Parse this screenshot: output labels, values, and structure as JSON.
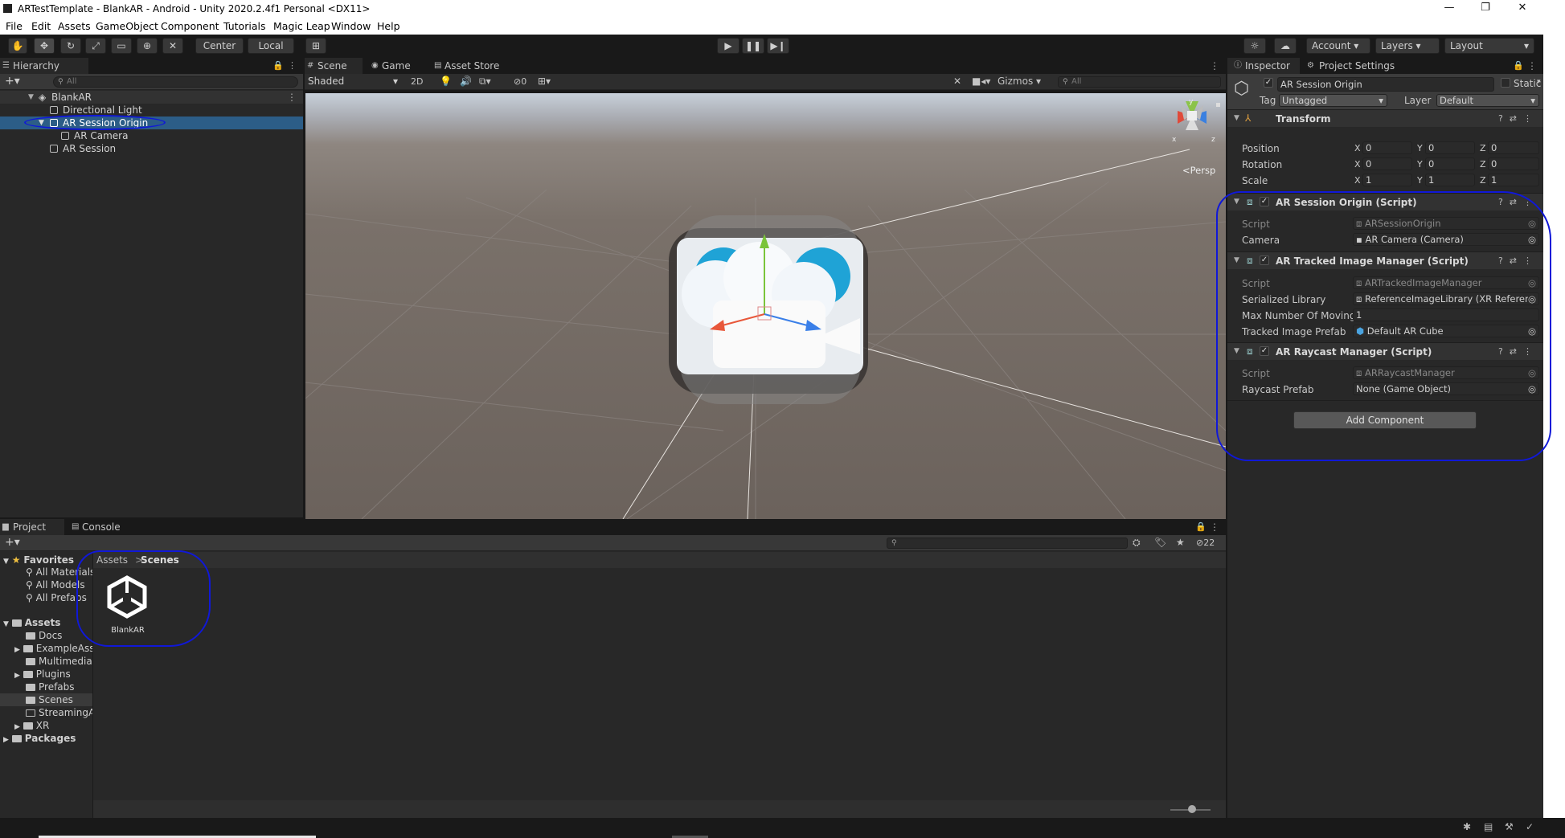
{
  "window": {
    "title": "ARTestTemplate - BlankAR - Android - Unity 2020.2.4f1 Personal <DX11>",
    "minimize": "—",
    "restore": "❐",
    "close": "✕"
  },
  "menu": [
    "File",
    "Edit",
    "Assets",
    "GameObject",
    "Component",
    "Tutorials",
    "Magic Leap",
    "Window",
    "Help"
  ],
  "toolbar": {
    "pivot": "Center",
    "space": "Local",
    "account": "Account",
    "layers": "Layers",
    "layout": "Layout"
  },
  "hierarchy": {
    "tab": "Hierarchy",
    "search_placeholder": "All",
    "scene": "BlankAR",
    "items": [
      "Directional Light",
      "AR Session Origin",
      "AR Camera",
      "AR Session"
    ]
  },
  "scene": {
    "tabs": [
      "Scene",
      "Game",
      "Asset Store"
    ],
    "shading": "Shaded",
    "mode2d": "2D",
    "fx_count": "0",
    "gizmos": "Gizmos",
    "search_placeholder": "All",
    "persp": "Persp",
    "axis_x": "x",
    "axis_z": "z",
    "axis_y": "y"
  },
  "inspector": {
    "tabs": [
      "Inspector",
      "Project Settings"
    ],
    "object_name": "AR Session Origin",
    "static": "Static",
    "tag_label": "Tag",
    "tag": "Untagged",
    "layer_label": "Layer",
    "layer": "Default",
    "transform": {
      "title": "Transform",
      "position": "Position",
      "rotation": "Rotation",
      "scale": "Scale",
      "X": "X",
      "Y": "Y",
      "Z": "Z",
      "pos": [
        "0",
        "0",
        "0"
      ],
      "rot": [
        "0",
        "0",
        "0"
      ],
      "scl": [
        "1",
        "1",
        "1"
      ]
    },
    "session_origin": {
      "title": "AR Session Origin (Script)",
      "script_label": "Script",
      "script": "ARSessionOrigin",
      "camera_label": "Camera",
      "camera": "AR Camera (Camera)"
    },
    "tracked_image": {
      "title": "AR Tracked Image Manager (Script)",
      "script_label": "Script",
      "script": "ARTrackedImageManager",
      "library_label": "Serialized Library",
      "library": "ReferenceImageLibrary (XR Referen",
      "max_label": "Max Number Of Moving I",
      "max": "1",
      "prefab_label": "Tracked Image Prefab",
      "prefab": "Default AR Cube"
    },
    "raycast": {
      "title": "AR Raycast Manager (Script)",
      "script_label": "Script",
      "script": "ARRaycastManager",
      "prefab_label": "Raycast Prefab",
      "prefab": "None (Game Object)"
    },
    "add_component": "Add Component"
  },
  "project": {
    "tabs": [
      "Project",
      "Console"
    ],
    "hidden_count": "22",
    "favorites": "Favorites",
    "fav_items": [
      "All Materials",
      "All Models",
      "All Prefabs"
    ],
    "assets": "Assets",
    "folders": [
      "Docs",
      "ExampleAss",
      "Multimedia",
      "Plugins",
      "Prefabs",
      "Scenes",
      "StreamingA",
      "XR"
    ],
    "packages": "Packages",
    "breadcrumb": [
      "Assets",
      "Scenes"
    ],
    "breadcrumb_sep": ">",
    "file": "BlankAR"
  }
}
